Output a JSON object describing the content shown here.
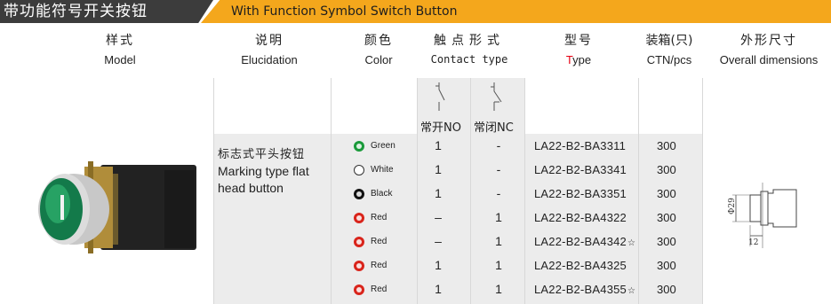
{
  "banner": {
    "cn_title": "带功能符号开关按钮",
    "en_title": "With Function Symbol Switch Button"
  },
  "header": {
    "model_cn": "样式",
    "model_en": "Model",
    "elucidation_cn": "说明",
    "elucidation_en": "Elucidation",
    "color_cn": "颜色",
    "color_en": "Color",
    "contact_cn": "触点形式",
    "contact_en": "Contact type",
    "type_cn": "型号",
    "type_en_prefix": "T",
    "type_en_rest": "ype",
    "ctn_cn": "装箱(只)",
    "ctn_en": "CTN/pcs",
    "dims_cn": "外形尺寸",
    "dims_en": "Overall dimensions"
  },
  "contacts": {
    "no": "常开NO",
    "nc": "常闭NC"
  },
  "description": {
    "cn": "标志式平头按钮",
    "en": "Marking type flat head button"
  },
  "accent_red": "#e60012",
  "rows": [
    {
      "color_name": "Green",
      "color_hex": "#1a9a3a",
      "no": "1",
      "nc": "-",
      "type": "LA22-B2-BA3311",
      "star": "",
      "qty": "300"
    },
    {
      "color_name": "White",
      "color_hex": "#ffffff",
      "no": "1",
      "nc": "-",
      "type": "LA22-B2-BA3341",
      "star": "",
      "qty": "300"
    },
    {
      "color_name": "Black",
      "color_hex": "#111111",
      "no": "1",
      "nc": "-",
      "type": "LA22-B2-BA3351",
      "star": "",
      "qty": "300"
    },
    {
      "color_name": "Red",
      "color_hex": "#d9241b",
      "no": "–",
      "nc": "1",
      "type": "LA22-B2-BA4322",
      "star": "",
      "qty": "300"
    },
    {
      "color_name": "Red",
      "color_hex": "#d9241b",
      "no": "–",
      "nc": "1",
      "type": "LA22-B2-BA4342",
      "star": "☆",
      "qty": "300"
    },
    {
      "color_name": "Red",
      "color_hex": "#d9241b",
      "no": "1",
      "nc": "1",
      "type": "LA22-B2-BA4325",
      "star": "",
      "qty": "300"
    },
    {
      "color_name": "Red",
      "color_hex": "#d9241b",
      "no": "1",
      "nc": "1",
      "type": "LA22-B2-BA4355",
      "star": "☆",
      "qty": "300"
    }
  ],
  "dimensions": {
    "diameter": "Φ29",
    "length": "12"
  }
}
